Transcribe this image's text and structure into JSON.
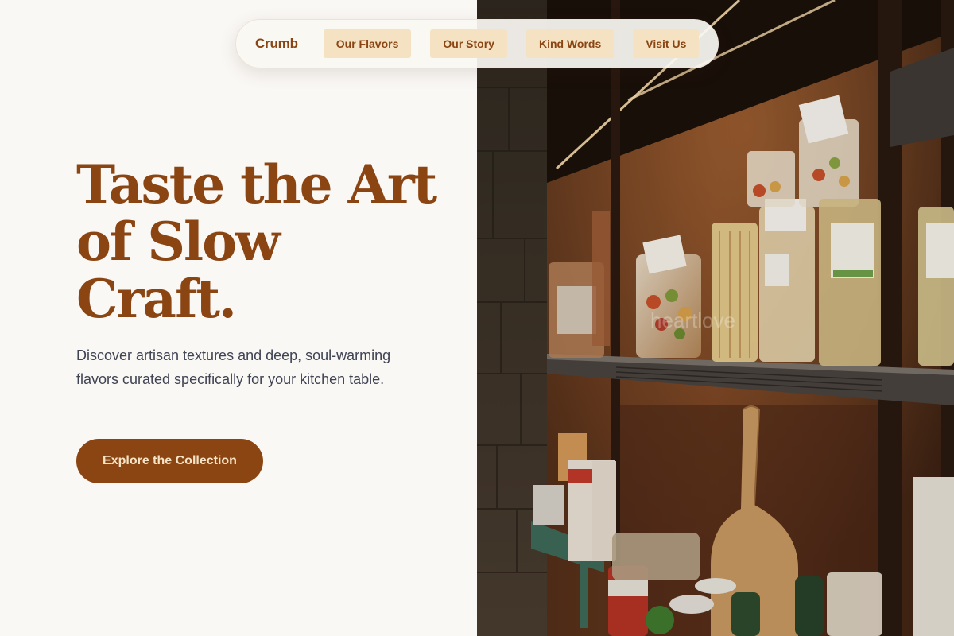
{
  "nav": {
    "brand": "Crumb",
    "links": [
      {
        "label": "Our Flavors"
      },
      {
        "label": "Our Story"
      },
      {
        "label": "Kind Words"
      },
      {
        "label": "Visit Us"
      }
    ]
  },
  "hero": {
    "headline": "Taste the Art of Slow Craft.",
    "subtext": "Discover artisan textures and deep, soul-warming flavors curated specifically for your kitchen table.",
    "cta_label": "Explore the Collection",
    "image_watermark": "heartlove"
  },
  "colors": {
    "accent": "#8b4513",
    "nav_pill_bg": "#f4e2c2",
    "cta_text": "#f6e4c6",
    "page_bg": "#faf8f5",
    "body_text": "#3f4352"
  },
  "icons": []
}
